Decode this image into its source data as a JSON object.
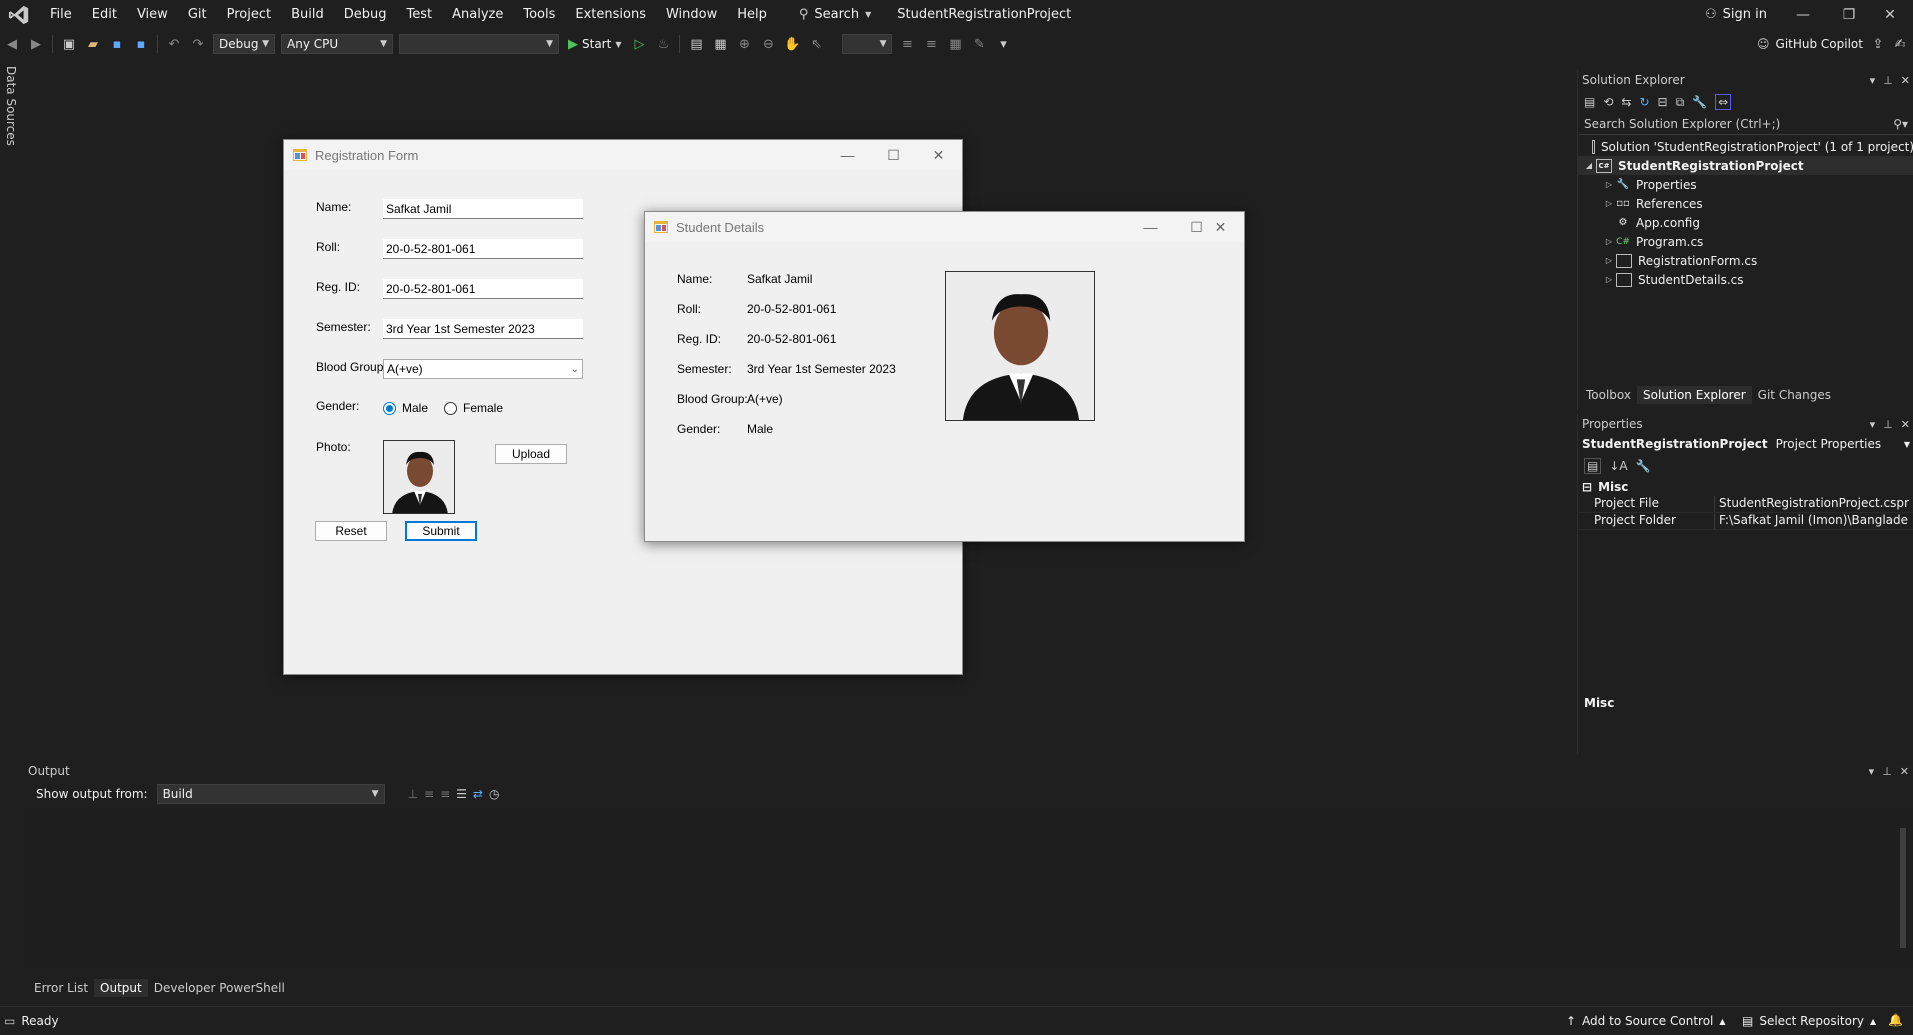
{
  "app": {
    "menu": [
      "File",
      "Edit",
      "View",
      "Git",
      "Project",
      "Build",
      "Debug",
      "Test",
      "Analyze",
      "Tools",
      "Extensions",
      "Window",
      "Help"
    ],
    "search_label": "Search",
    "project_title": "StudentRegistrationProject",
    "sign_in": "Sign in",
    "copilot": "GitHub Copilot"
  },
  "toolbar": {
    "config": "Debug",
    "platform": "Any CPU",
    "start_label": "Start"
  },
  "left_strip": "Data Sources",
  "registration_form": {
    "title": "Registration Form",
    "name_label": "Name:",
    "name_value": "Safkat Jamil",
    "roll_label": "Roll:",
    "roll_value": "20-0-52-801-061",
    "regid_label": "Reg. ID:",
    "regid_value": "20-0-52-801-061",
    "semester_label": "Semester:",
    "semester_value": "3rd Year 1st Semester 2023",
    "blood_label": "Blood Group:",
    "blood_value": "A(+ve)",
    "gender_label": "Gender:",
    "gender_male": "Male",
    "gender_female": "Female",
    "photo_label": "Photo:",
    "upload": "Upload",
    "reset": "Reset",
    "submit": "Submit"
  },
  "student_details": {
    "title": "Student Details",
    "rows": [
      {
        "label": "Name:",
        "value": "Safkat Jamil"
      },
      {
        "label": "Roll:",
        "value": "20-0-52-801-061"
      },
      {
        "label": "Reg. ID:",
        "value": "20-0-52-801-061"
      },
      {
        "label": "Semester:",
        "value": "3rd Year 1st Semester 2023"
      },
      {
        "label": "Blood Group:",
        "value": "A(+ve)"
      },
      {
        "label": "Gender:",
        "value": "Male"
      }
    ]
  },
  "solution_explorer": {
    "title": "Solution Explorer",
    "search_placeholder": "Search Solution Explorer (Ctrl+;)",
    "solution": "Solution 'StudentRegistrationProject' (1 of 1 project)",
    "project": "StudentRegistrationProject",
    "items": [
      "Properties",
      "References",
      "App.config",
      "Program.cs",
      "RegistrationForm.cs",
      "StudentDetails.cs"
    ],
    "tabs": [
      "Toolbox",
      "Solution Explorer",
      "Git Changes"
    ]
  },
  "properties": {
    "title": "Properties",
    "object": "StudentRegistrationProject",
    "object_type": "Project Properties",
    "category": "Misc",
    "rows": [
      {
        "key": "Project File",
        "value": "StudentRegistrationProject.cspr"
      },
      {
        "key": "Project Folder",
        "value": "F:\\Safkat Jamil (Imon)\\Banglade"
      }
    ],
    "description_title": "Misc"
  },
  "output": {
    "title": "Output",
    "show_from_label": "Show output from:",
    "show_from_value": "Build",
    "tabs": [
      "Error List",
      "Output",
      "Developer PowerShell"
    ]
  },
  "status": {
    "ready": "Ready",
    "add_source": "Add to Source Control",
    "select_repo": "Select Repository"
  },
  "colors": {
    "ide_bg": "#1f1f1f",
    "form_bg": "#f0f0f0",
    "accent": "#0078d7",
    "start_green": "#4ec25c"
  }
}
